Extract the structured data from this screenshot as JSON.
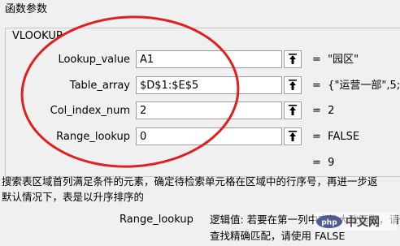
{
  "dialog": {
    "title": "函数参数",
    "function_name": "VLOOKUP"
  },
  "arguments": [
    {
      "label": "Lookup_value",
      "value": "A1",
      "equals": "=",
      "result": "\"园区\""
    },
    {
      "label": "Table_array",
      "value": "$D$1:$E$5",
      "equals": "=",
      "result": "{\"运营一部\",5;\""
    },
    {
      "label": "Col_index_num",
      "value": "2",
      "equals": "=",
      "result": "2"
    },
    {
      "label": "Range_lookup",
      "value": "0",
      "equals": "=",
      "result": "FALSE"
    }
  ],
  "formula_result": {
    "equals": "=",
    "value": "9"
  },
  "description": {
    "line1": "搜索表区域首列满足条件的元素，确定待检索单元格在区域中的行序号，再进一步返",
    "line2": "默认情况下，表是以升序排序的"
  },
  "parameter_help": {
    "name": "Range_lookup",
    "line1": "逻辑值: 若要在第一列中查找大致匹配，请使用",
    "line2": "查找精确匹配，请使用 FALSE"
  },
  "watermark": {
    "text": "中文网",
    "logo": "php-logo"
  },
  "colors": {
    "annotation_circle": "#e02020",
    "ref_arrow": "#000000"
  }
}
